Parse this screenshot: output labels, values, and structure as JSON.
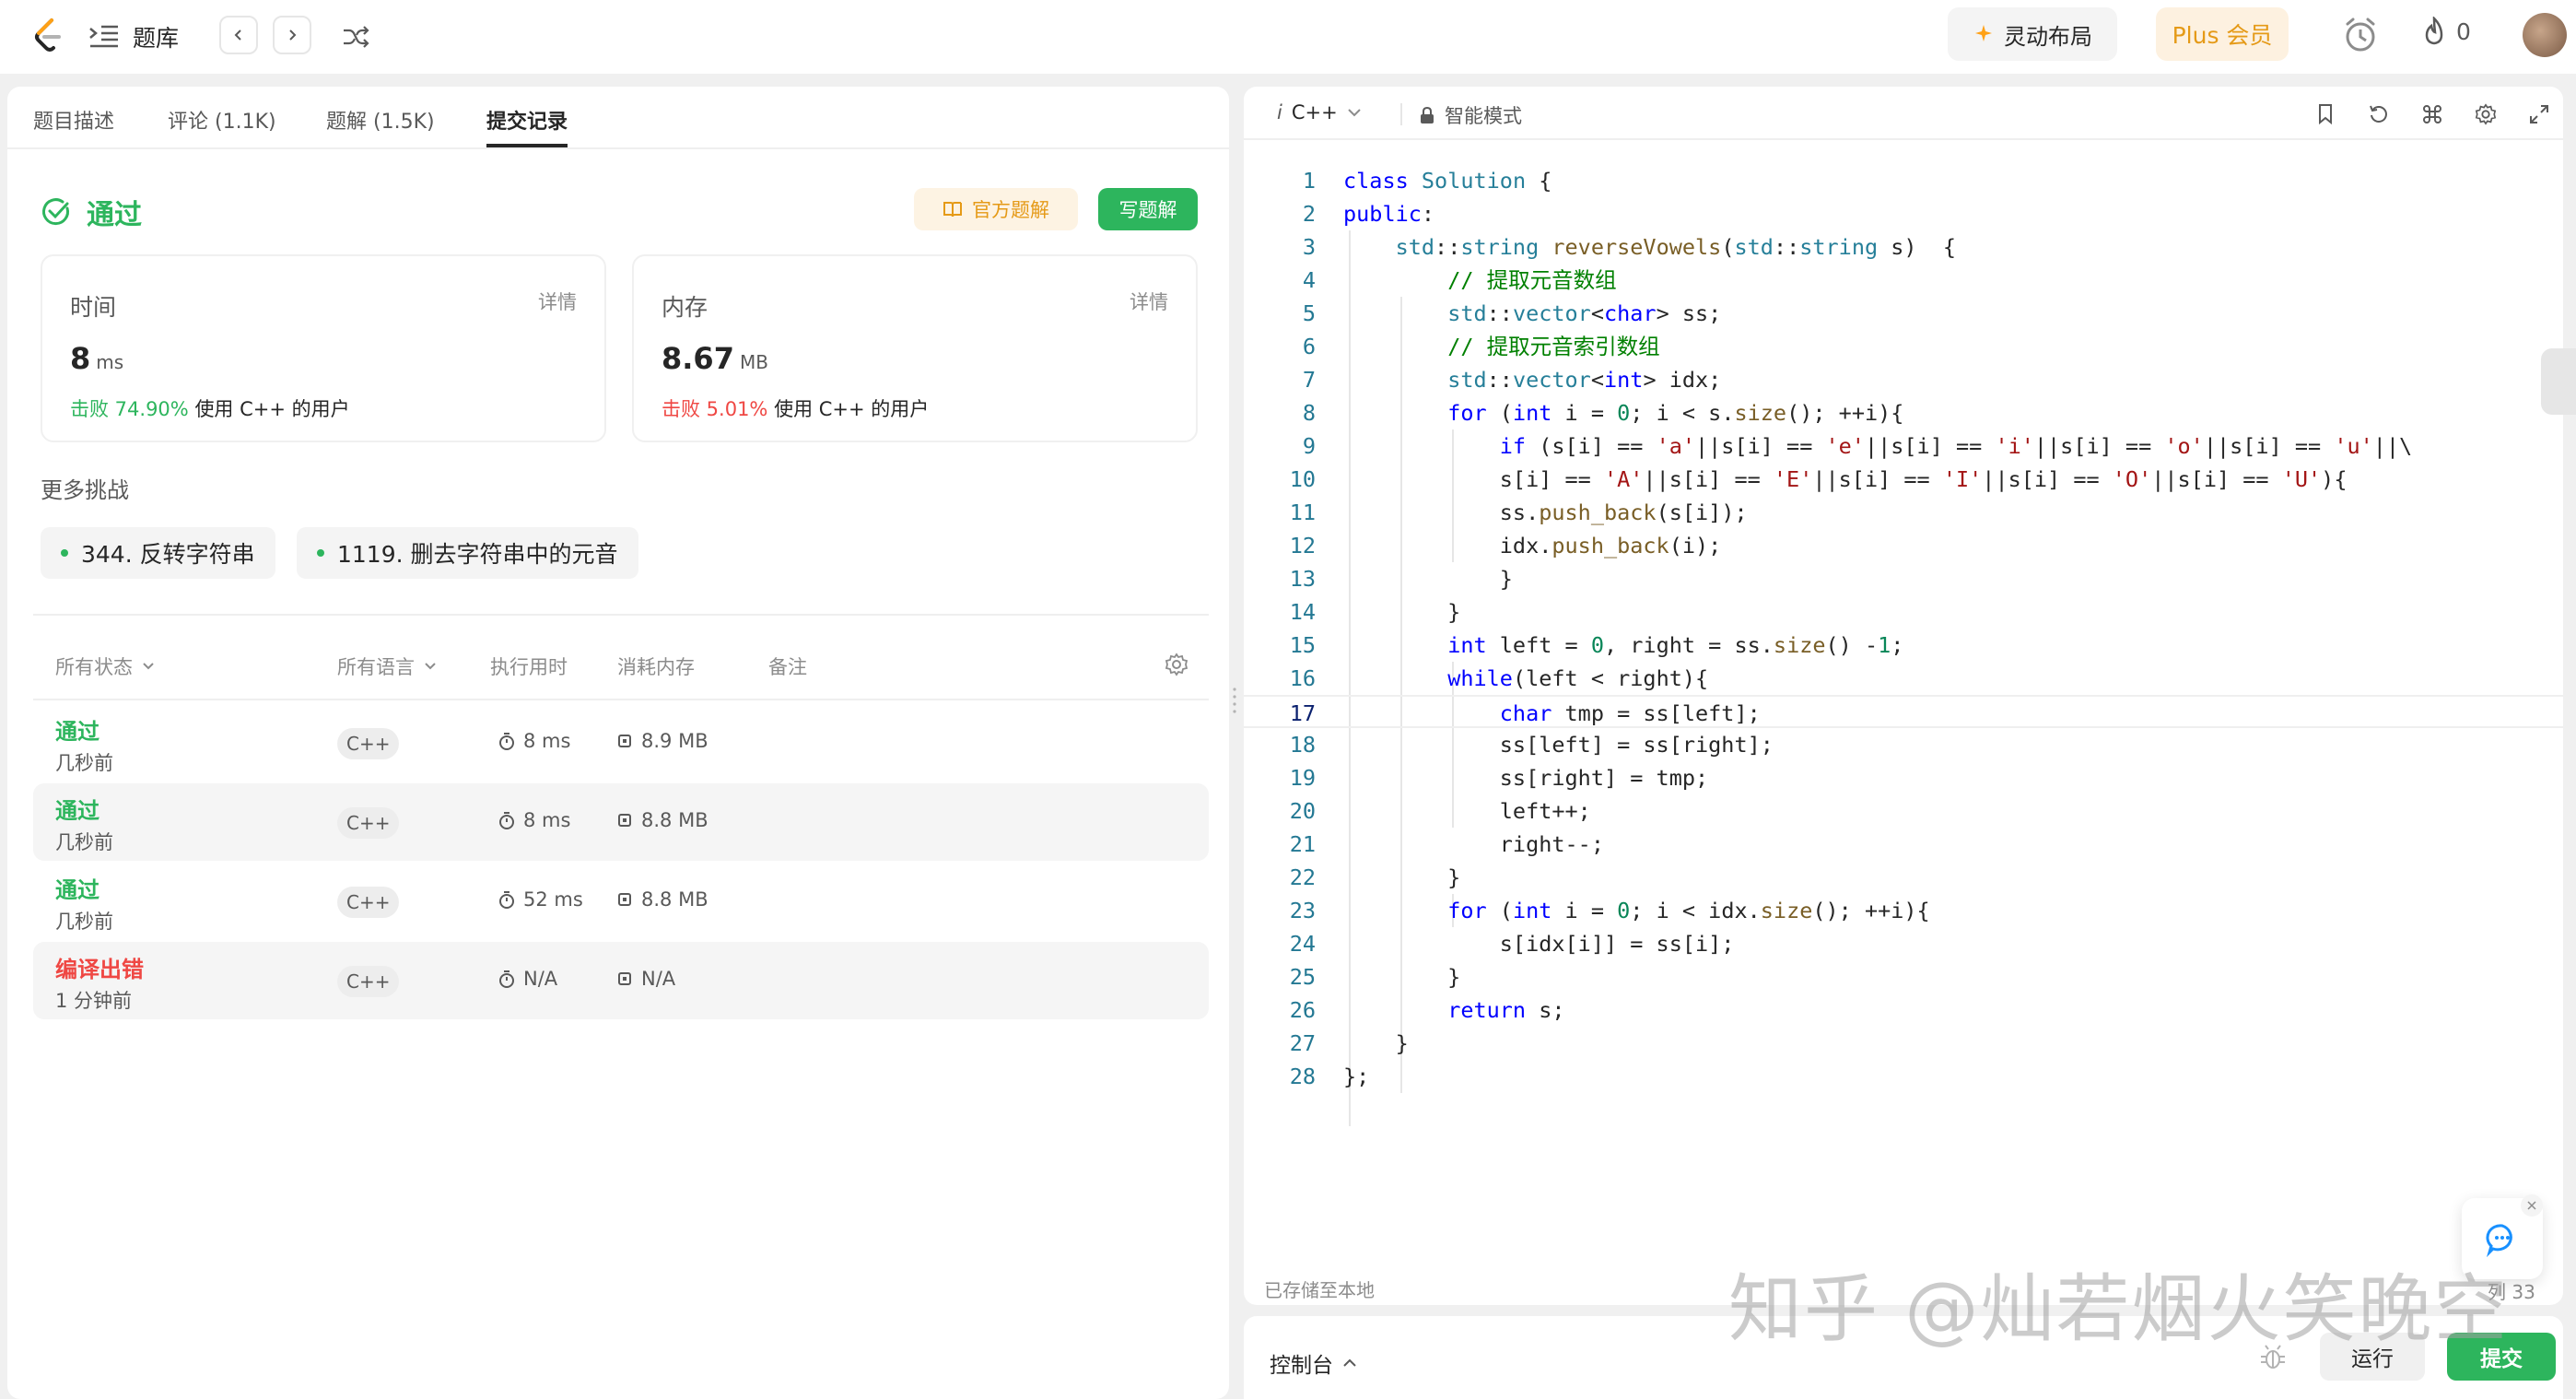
{
  "topbar": {
    "list_label": "题库",
    "layout_label": "灵动布局",
    "plus_label": "Plus 会员",
    "streak_count": "0",
    "accent_color": "#2db55d",
    "plus_color": "#e59a17"
  },
  "left": {
    "tabs": [
      {
        "label": "题目描述"
      },
      {
        "label": "评论 (1.1K)"
      },
      {
        "label": "题解 (1.5K)"
      },
      {
        "label": "提交记录"
      }
    ],
    "status": "通过",
    "official_solution": "官方题解",
    "write_solution": "写题解",
    "runtime": {
      "title": "时间",
      "detail": "详情",
      "value": "8",
      "unit": "ms",
      "beat_pct": "击败 74.90%",
      "beat_text": "使用 C++ 的用户"
    },
    "memory": {
      "title": "内存",
      "detail": "详情",
      "value": "8.67",
      "unit": "MB",
      "beat_pct": "击败 5.01%",
      "beat_text": "使用 C++ 的用户"
    },
    "more_challenges_title": "更多挑战",
    "challenges": [
      {
        "label": "344. 反转字符串"
      },
      {
        "label": "1119. 删去字符串中的元音"
      }
    ],
    "table": {
      "headers": {
        "status": "所有状态",
        "language": "所有语言",
        "runtime": "执行用时",
        "memory": "消耗内存",
        "notes": "备注"
      },
      "rows": [
        {
          "status": "通过",
          "ago": "几秒前",
          "lang": "C++",
          "runtime": "8 ms",
          "memory": "8.9 MB"
        },
        {
          "status": "通过",
          "ago": "几秒前",
          "lang": "C++",
          "runtime": "8 ms",
          "memory": "8.8 MB"
        },
        {
          "status": "通过",
          "ago": "几秒前",
          "lang": "C++",
          "runtime": "52 ms",
          "memory": "8.8 MB"
        },
        {
          "status": "编译出错",
          "ago": "1 分钟前",
          "lang": "C++",
          "runtime": "N/A",
          "memory": "N/A"
        }
      ]
    }
  },
  "editor": {
    "language": "C++",
    "language_prefix": "i",
    "mode": "智能模式",
    "saved_text": "已存储至本地",
    "col_info": "列 33",
    "current_line": 17,
    "lines": [
      "class Solution {",
      "public:",
      "    std::string reverseVowels(std::string s)  {",
      "        // 提取元音数组",
      "        std::vector<char> ss;",
      "        // 提取元音索引数组",
      "        std::vector<int> idx;",
      "        for (int i = 0; i < s.size(); ++i){",
      "            if (s[i] == 'a'||s[i] == 'e'||s[i] == 'i'||s[i] == 'o'||s[i] == 'u'||\\",
      "            s[i] == 'A'||s[i] == 'E'||s[i] == 'I'||s[i] == 'O'||s[i] == 'U'){",
      "            ss.push_back(s[i]);",
      "            idx.push_back(i);",
      "            }",
      "        }",
      "        int left = 0, right = ss.size() -1;",
      "        while(left < right){",
      "            char tmp = ss[left];",
      "            ss[left] = ss[right];",
      "            ss[right] = tmp;",
      "            left++;",
      "            right--;",
      "        }",
      "        for (int i = 0; i < idx.size(); ++i){",
      "            s[idx[i]] = ss[i];",
      "        }",
      "        return s;",
      "    }",
      "};"
    ]
  },
  "console": {
    "label": "控制台",
    "run": "运行",
    "submit": "提交"
  },
  "watermark": "知乎 @灿若烟火笑晚空"
}
